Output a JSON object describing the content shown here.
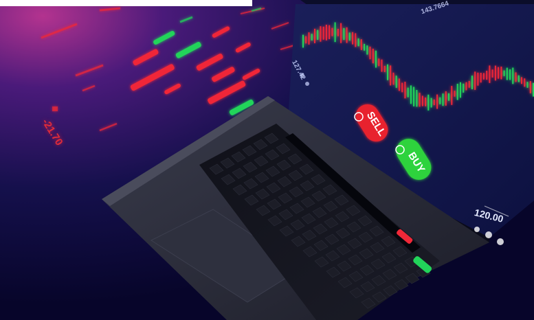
{
  "labels": {
    "negative_value": "-21.70",
    "top_price": "143.7664",
    "left_price": "127.42",
    "amount": "120.00"
  },
  "buttons": {
    "sell": "SELL",
    "buy": "BUY"
  },
  "colors": {
    "background_dark": "#0a0630",
    "glow_magenta": "#9b2a8a",
    "candle_red": "#f02838",
    "candle_green": "#22d45a",
    "laptop_body": "#2b2d3a",
    "key": "#16171f"
  }
}
